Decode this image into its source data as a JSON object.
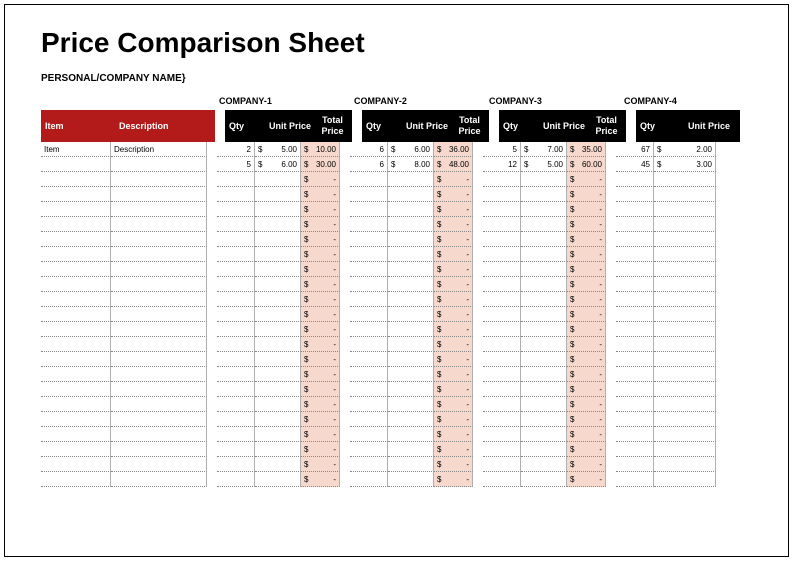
{
  "title": "Price Comparison Sheet",
  "subtitle": "PERSONAL/COMPANY NAME}",
  "companies": [
    "COMPANY-1",
    "COMPANY-2",
    "COMPANY-3",
    "COMPANY-4"
  ],
  "headers": {
    "item": "Item",
    "description": "Description",
    "qty": "Qty",
    "unit_price": "Unit Price",
    "total_price": "Total\nPrice"
  },
  "currency": "$",
  "dash": "-",
  "rows": [
    {
      "item": "Item",
      "desc": "Description",
      "c1": {
        "qty": "2",
        "unit": "5.00",
        "total": "10.00"
      },
      "c2": {
        "qty": "6",
        "unit": "6.00",
        "total": "36.00"
      },
      "c3": {
        "qty": "5",
        "unit": "7.00",
        "total": "35.00"
      },
      "c4": {
        "qty": "67",
        "unit": "2.00"
      }
    },
    {
      "item": "",
      "desc": "",
      "c1": {
        "qty": "5",
        "unit": "6.00",
        "total": "30.00"
      },
      "c2": {
        "qty": "6",
        "unit": "8.00",
        "total": "48.00"
      },
      "c3": {
        "qty": "12",
        "unit": "5.00",
        "total": "60.00"
      },
      "c4": {
        "qty": "45",
        "unit": "3.00"
      }
    }
  ],
  "empty_row_count": 21
}
